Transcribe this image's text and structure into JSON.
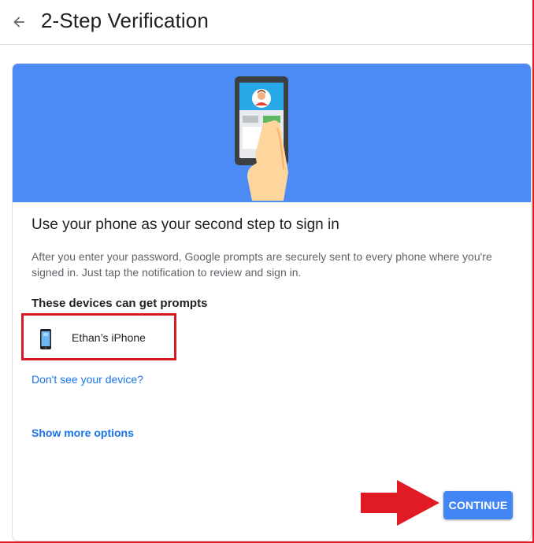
{
  "header": {
    "title": "2-Step Verification",
    "back_icon": "arrow-back-icon"
  },
  "card": {
    "heading": "Use your phone as your second step to sign in",
    "description": "After you enter your password, Google prompts are securely sent to every phone where you're signed in. Just tap the notification to review and sign in.",
    "devices_heading": "These devices can get prompts",
    "devices": [
      {
        "name": "Ethan’s iPhone",
        "icon": "iphone-icon"
      }
    ],
    "missing_device_link": "Don't see your device?",
    "more_options_link": "Show more options",
    "continue_label": "CONTINUE"
  },
  "colors": {
    "hero_background": "#4c8bf5",
    "button": "#4285f4",
    "link": "#1a73e8",
    "highlight_annotation": "#d71921"
  }
}
